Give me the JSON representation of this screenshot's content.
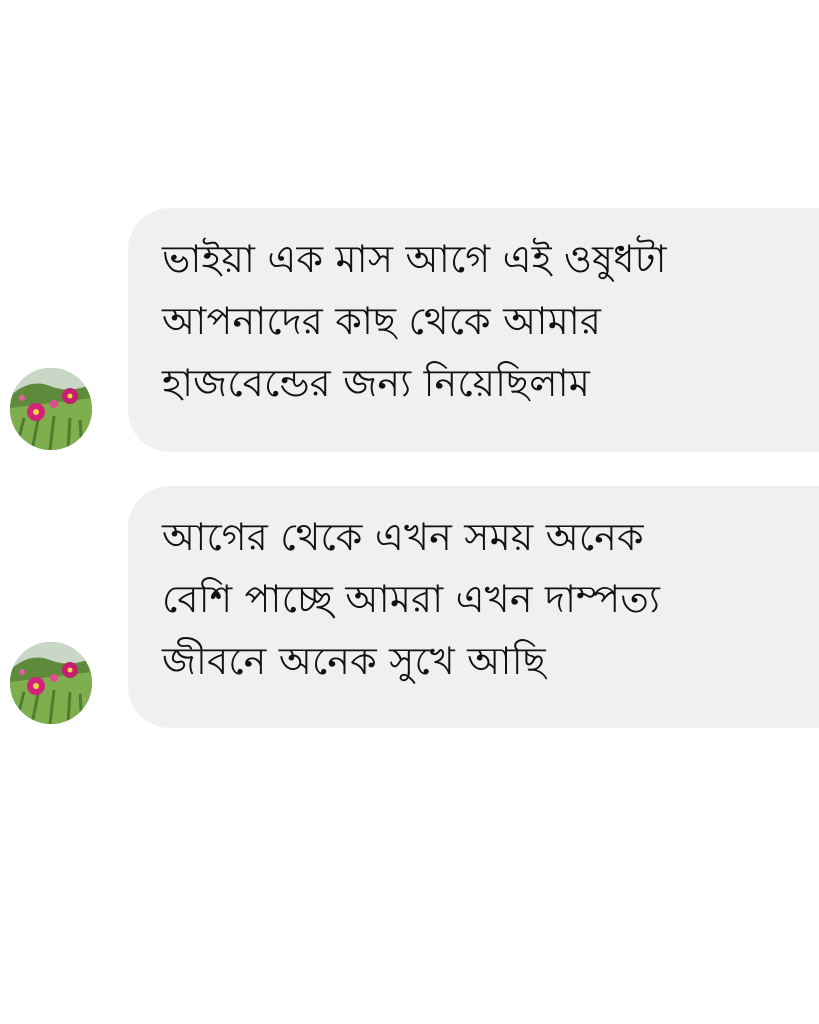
{
  "messages": [
    {
      "avatar": "flower-avatar",
      "lines": [
        "ভাইয়া এক মাস  আগে এই ওষুধটা",
        "আপনাদের কাছ থেকে আমার",
        "হাজবেন্ডের জন্য নিয়েছিলাম"
      ]
    },
    {
      "avatar": "flower-avatar",
      "lines": [
        "আগের থেকে এখন সময় অনেক",
        "বেশি পাচ্ছে আমরা এখন দাম্পত্য",
        "জীবনে অনেক সুখে আছি"
      ]
    }
  ],
  "colors": {
    "background": "#ffffff",
    "bubble": "#f0f0f0",
    "text": "#111111"
  }
}
